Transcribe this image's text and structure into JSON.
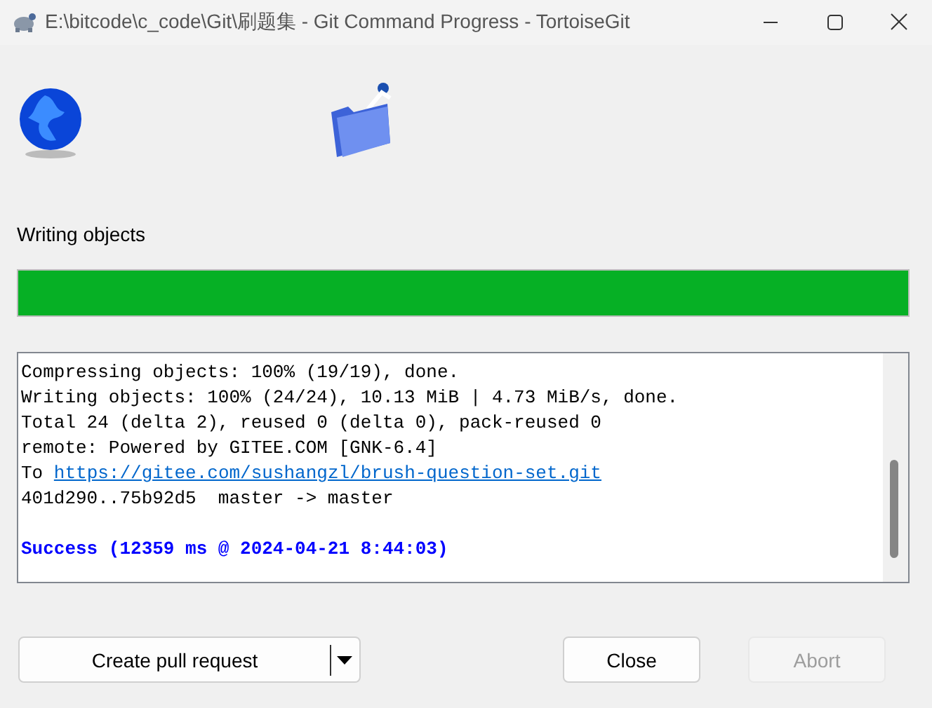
{
  "window": {
    "title": "E:\\bitcode\\c_code\\Git\\刷题集 - Git Command Progress - TortoiseGit"
  },
  "status": {
    "label": "Writing objects"
  },
  "progress": {
    "level": 1.0
  },
  "log": [
    {
      "kind": "text",
      "text": "Compressing objects: 100% (19/19), done."
    },
    {
      "kind": "text",
      "text": "Writing objects: 100% (24/24), 10.13 MiB | 4.73 MiB/s, done."
    },
    {
      "kind": "text",
      "text": "Total 24 (delta 2), reused 0 (delta 0), pack-reused 0"
    },
    {
      "kind": "text",
      "text": "remote: Powered by GITEE.COM [GNK-6.4]"
    },
    {
      "kind": "link",
      "prefix": "To",
      "url": "https://gitee.com/sushangzl/brush-question-set.git"
    },
    {
      "kind": "text",
      "text": "401d290..75b92d5  master -> master"
    },
    {
      "kind": "success",
      "text": "Success (12359 ms @ 2024-04-21 8:44:03)"
    }
  ],
  "buttons": [
    {
      "kind": "split",
      "label": "Create pull request",
      "disabled": false
    },
    {
      "kind": "plain",
      "label": "Close",
      "disabled": false
    },
    {
      "kind": "plain",
      "label": "Abort",
      "disabled": true
    }
  ]
}
